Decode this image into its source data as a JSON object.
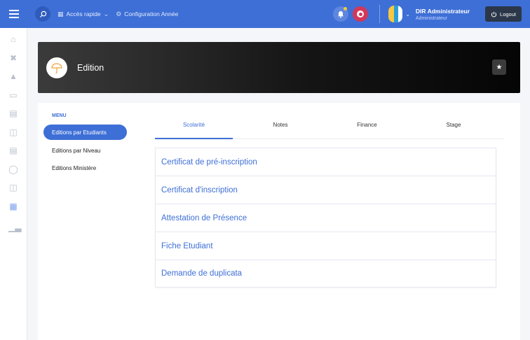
{
  "topbar": {
    "quick_access_label": "Accès rapide",
    "config_label": "Configuration Année",
    "user_name": "DIR Administrateur",
    "user_role": "Administrateur",
    "logout_label": "Logout",
    "accent": "#3e6fd6"
  },
  "rail": {
    "icons": [
      "home-icon",
      "tools-icon",
      "graduation-icon",
      "monitor-icon",
      "calendar-icon",
      "book-icon",
      "clipboard-icon",
      "shield-icon",
      "open-book-icon",
      "printer-icon",
      "bar-chart-icon"
    ],
    "active": "printer-icon"
  },
  "banner": {
    "title": "Edition",
    "logo_icon": "umbrella-icon",
    "action_icon": "star-icon"
  },
  "menu": {
    "heading": "MENU",
    "items": [
      {
        "label": "Editions par Etudiants",
        "active": true
      },
      {
        "label": "Editions par Niveau",
        "active": false
      },
      {
        "label": "Editions Ministère",
        "active": false
      }
    ]
  },
  "tabs": [
    {
      "label": "Scolarité",
      "active": true
    },
    {
      "label": "Notes",
      "active": false
    },
    {
      "label": "Finance",
      "active": false
    },
    {
      "label": "Stage",
      "active": false
    }
  ],
  "documents": [
    "Certificat de pré-inscription",
    "Certificat d'inscription",
    "Attestation de Présence",
    "Fiche Etudiant",
    "Demande de duplicata"
  ]
}
